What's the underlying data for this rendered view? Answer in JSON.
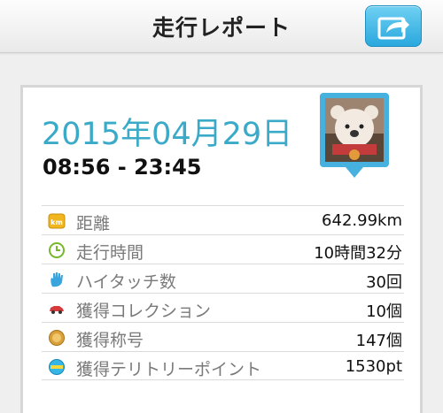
{
  "header": {
    "title": "走行レポート",
    "share_icon": "share-arrow-icon",
    "accent": "#2aa8de"
  },
  "report": {
    "date": "2015年04月29日",
    "time_range": "08:56 - 23:45",
    "date_color": "#3aaac8",
    "avatar_icon": "bear-avatar-icon"
  },
  "stats": [
    {
      "icon": "km-icon",
      "label": "距離",
      "value": "642.99km"
    },
    {
      "icon": "clock-icon",
      "label": "走行時間",
      "value": "10時間32分"
    },
    {
      "icon": "hand-icon",
      "label": "ハイタッチ数",
      "value": "30回"
    },
    {
      "icon": "car-icon",
      "label": "獲得コレクション",
      "value": "10個"
    },
    {
      "icon": "medal-icon",
      "label": "獲得称号",
      "value": "147個"
    },
    {
      "icon": "territory-icon",
      "label": "獲得テリトリーポイント",
      "value": "1530pt"
    }
  ]
}
